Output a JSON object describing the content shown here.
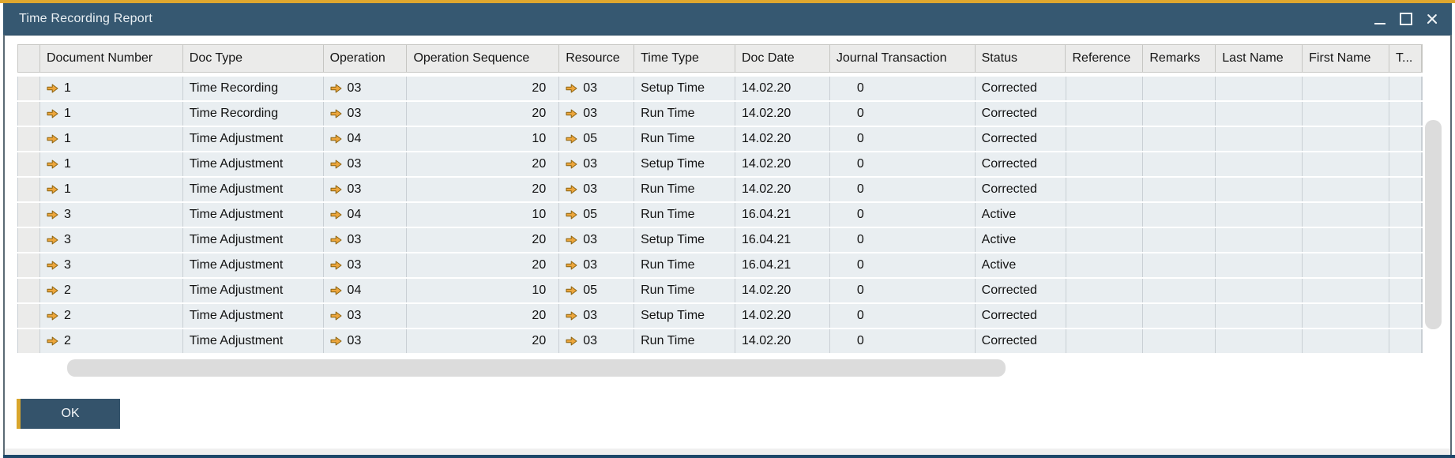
{
  "window": {
    "title": "Time Recording Report",
    "controls": {
      "minimize": "minimize",
      "maximize": "maximize",
      "close": "close"
    }
  },
  "colors": {
    "accent_orange": "#DFA72E",
    "titlebar": "#365871",
    "header_bg": "#EBEBEA",
    "row_bg": "#E9EEF1",
    "button_bg": "#34536B",
    "link_arrow": "#EDA63C"
  },
  "icons": {
    "link_arrow": "orange-right-link-arrow",
    "minimize": "underscore",
    "maximize": "square-outline",
    "close": "x-cross"
  },
  "table": {
    "columns": [
      "",
      "Document Number",
      "Doc Type",
      "Operation",
      "Operation Sequence",
      "Resource",
      "Time Type",
      "Doc Date",
      "Journal Transaction",
      "Status",
      "Reference",
      "Remarks",
      "Last Name",
      "First Name",
      "T..."
    ],
    "rows": [
      {
        "document_number": "1",
        "doc_type": "Time Recording",
        "operation": "03",
        "operation_sequence": "20",
        "resource": "03",
        "time_type": "Setup Time",
        "doc_date": "14.02.20",
        "journal_transaction": "0",
        "status": "Corrected",
        "reference": "",
        "remarks": "",
        "last_name": "",
        "first_name": "",
        "t": ""
      },
      {
        "document_number": "1",
        "doc_type": "Time Recording",
        "operation": "03",
        "operation_sequence": "20",
        "resource": "03",
        "time_type": "Run Time",
        "doc_date": "14.02.20",
        "journal_transaction": "0",
        "status": "Corrected",
        "reference": "",
        "remarks": "",
        "last_name": "",
        "first_name": "",
        "t": ""
      },
      {
        "document_number": "1",
        "doc_type": "Time Adjustment",
        "operation": "04",
        "operation_sequence": "10",
        "resource": "05",
        "time_type": "Run Time",
        "doc_date": "14.02.20",
        "journal_transaction": "0",
        "status": "Corrected",
        "reference": "",
        "remarks": "",
        "last_name": "",
        "first_name": "",
        "t": ""
      },
      {
        "document_number": "1",
        "doc_type": "Time Adjustment",
        "operation": "03",
        "operation_sequence": "20",
        "resource": "03",
        "time_type": "Setup Time",
        "doc_date": "14.02.20",
        "journal_transaction": "0",
        "status": "Corrected",
        "reference": "",
        "remarks": "",
        "last_name": "",
        "first_name": "",
        "t": ""
      },
      {
        "document_number": "1",
        "doc_type": "Time Adjustment",
        "operation": "03",
        "operation_sequence": "20",
        "resource": "03",
        "time_type": "Run Time",
        "doc_date": "14.02.20",
        "journal_transaction": "0",
        "status": "Corrected",
        "reference": "",
        "remarks": "",
        "last_name": "",
        "first_name": "",
        "t": ""
      },
      {
        "document_number": "3",
        "doc_type": "Time Adjustment",
        "operation": "04",
        "operation_sequence": "10",
        "resource": "05",
        "time_type": "Run Time",
        "doc_date": "16.04.21",
        "journal_transaction": "0",
        "status": "Active",
        "reference": "",
        "remarks": "",
        "last_name": "",
        "first_name": "",
        "t": ""
      },
      {
        "document_number": "3",
        "doc_type": "Time Adjustment",
        "operation": "03",
        "operation_sequence": "20",
        "resource": "03",
        "time_type": "Setup Time",
        "doc_date": "16.04.21",
        "journal_transaction": "0",
        "status": "Active",
        "reference": "",
        "remarks": "",
        "last_name": "",
        "first_name": "",
        "t": ""
      },
      {
        "document_number": "3",
        "doc_type": "Time Adjustment",
        "operation": "03",
        "operation_sequence": "20",
        "resource": "03",
        "time_type": "Run Time",
        "doc_date": "16.04.21",
        "journal_transaction": "0",
        "status": "Active",
        "reference": "",
        "remarks": "",
        "last_name": "",
        "first_name": "",
        "t": ""
      },
      {
        "document_number": "2",
        "doc_type": "Time Adjustment",
        "operation": "04",
        "operation_sequence": "10",
        "resource": "05",
        "time_type": "Run Time",
        "doc_date": "14.02.20",
        "journal_transaction": "0",
        "status": "Corrected",
        "reference": "",
        "remarks": "",
        "last_name": "",
        "first_name": "",
        "t": ""
      },
      {
        "document_number": "2",
        "doc_type": "Time Adjustment",
        "operation": "03",
        "operation_sequence": "20",
        "resource": "03",
        "time_type": "Setup Time",
        "doc_date": "14.02.20",
        "journal_transaction": "0",
        "status": "Corrected",
        "reference": "",
        "remarks": "",
        "last_name": "",
        "first_name": "",
        "t": ""
      },
      {
        "document_number": "2",
        "doc_type": "Time Adjustment",
        "operation": "03",
        "operation_sequence": "20",
        "resource": "03",
        "time_type": "Run Time",
        "doc_date": "14.02.20",
        "journal_transaction": "0",
        "status": "Corrected",
        "reference": "",
        "remarks": "",
        "last_name": "",
        "first_name": "",
        "t": ""
      }
    ]
  },
  "footer": {
    "ok_label": "OK"
  }
}
